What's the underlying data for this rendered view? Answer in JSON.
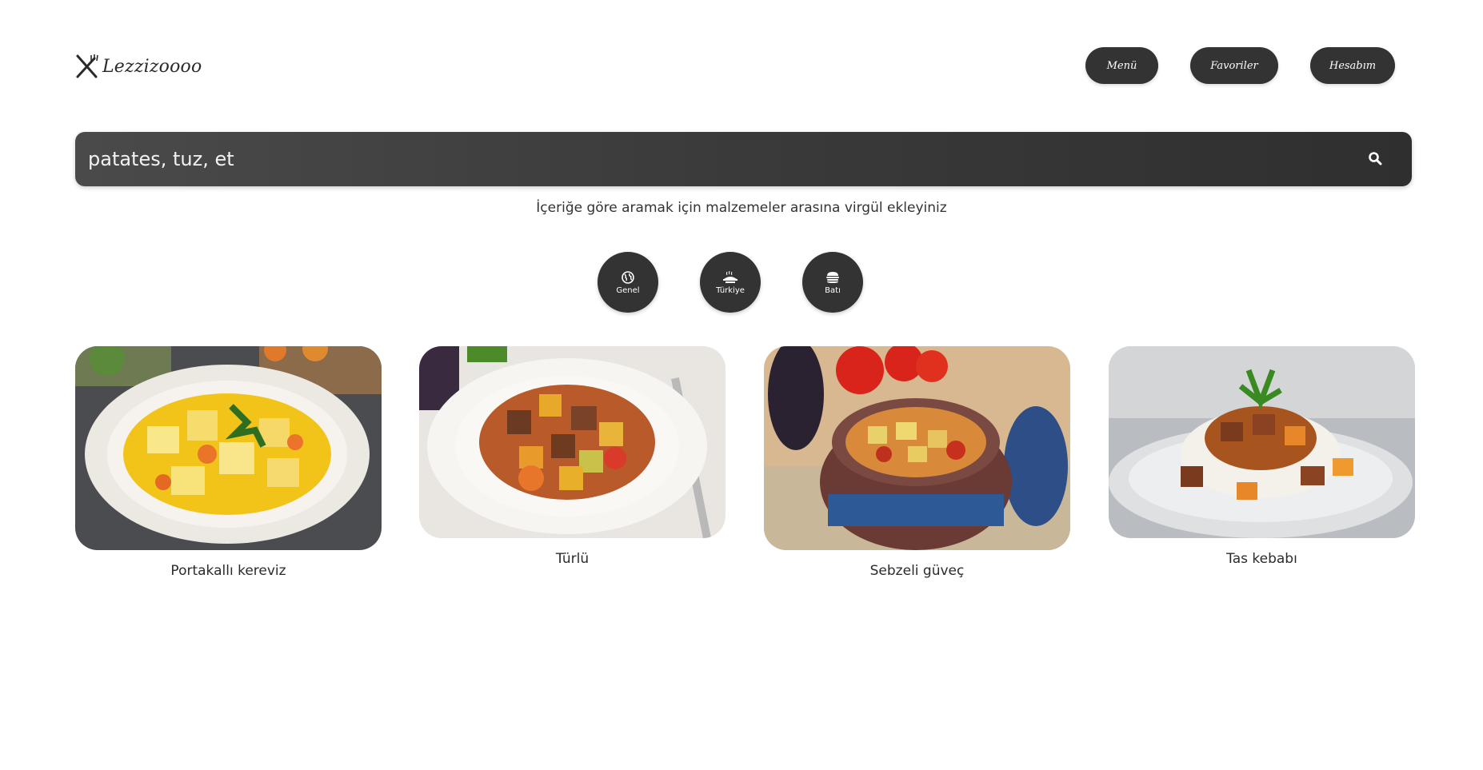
{
  "header": {
    "logo_text": "Lezzizoooo",
    "nav": {
      "menu_label": "Menü",
      "favorites_label": "Favoriler",
      "account_label": "Hesabım"
    }
  },
  "search": {
    "value": "patates, tuz, et",
    "hint": "İçeriğe göre aramak için malzemeler arasına virgül ekleyiniz",
    "button_icon": "search-icon"
  },
  "categories": [
    {
      "label": "Genel",
      "icon": "globe-icon"
    },
    {
      "label": "Türkiye",
      "icon": "turkish-food-icon"
    },
    {
      "label": "Batı",
      "icon": "burger-icon"
    }
  ],
  "recipes": [
    {
      "title": "Portakallı kereviz",
      "image": "celery-orange-dish"
    },
    {
      "title": "Türlü",
      "image": "vegetable-stew-dish"
    },
    {
      "title": "Sebzeli güveç",
      "image": "clay-pot-casserole"
    },
    {
      "title": "Tas kebabı",
      "image": "tas-kebab-rice-dish"
    }
  ],
  "colors": {
    "button_bg": "#333333",
    "button_text": "#ffffff",
    "background": "#ffffff",
    "search_bg": "#3d3d3d"
  }
}
